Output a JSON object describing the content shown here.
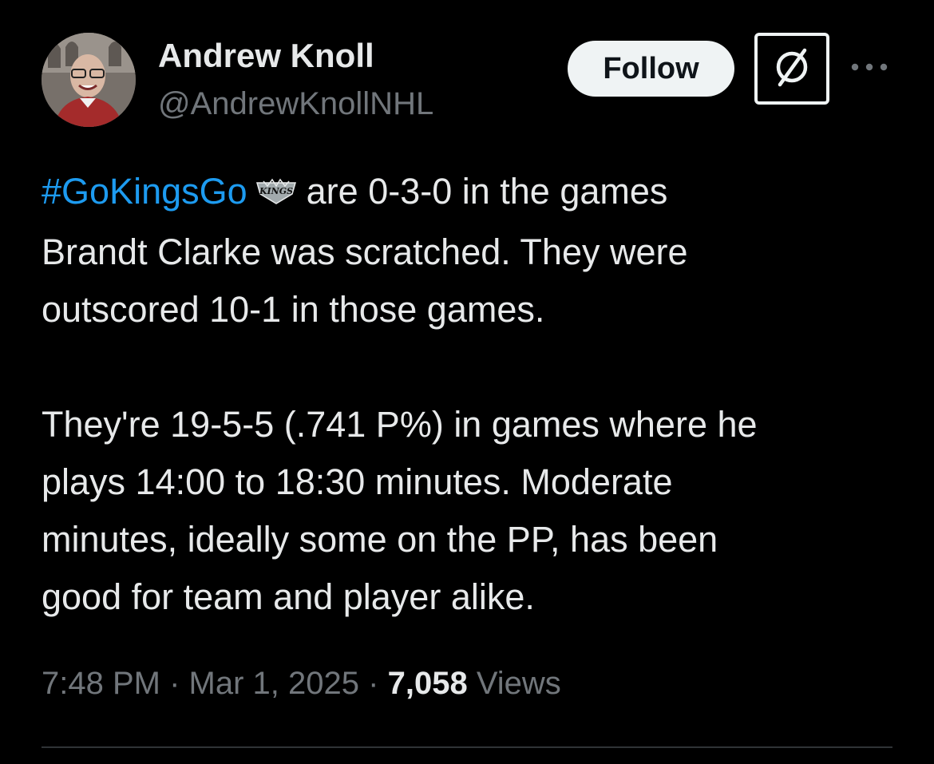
{
  "author": {
    "display_name": "Andrew Knoll",
    "handle": "@AndrewKnollNHL"
  },
  "actions": {
    "follow_label": "Follow",
    "grok_icon": "grok-icon",
    "more_icon": "more-horizontal-icon"
  },
  "tweet": {
    "hashtag": "#GoKingsGo",
    "hashflag_text": "KINGS",
    "line1_rest": "are 0-3-0 in the games",
    "line2": "Brandt Clarke was scratched. They were",
    "line3": "outscored 10-1 in those games.",
    "line4": "They're 19-5-5 (.741 P%) in games where he",
    "line5": "plays 14:00 to 18:30 minutes. Moderate",
    "line6": "minutes, ideally some on the PP, has been",
    "line7": "good for team and player alike."
  },
  "meta": {
    "time": "7:48 PM",
    "separator": "·",
    "date": "Mar 1, 2025",
    "views_count": "7,058",
    "views_label": "Views"
  },
  "colors": {
    "background": "#000000",
    "text": "#e7e9ea",
    "secondary": "#71767b",
    "link": "#1d9bf0",
    "divider": "#2f3336",
    "follow_bg": "#eff3f4"
  }
}
